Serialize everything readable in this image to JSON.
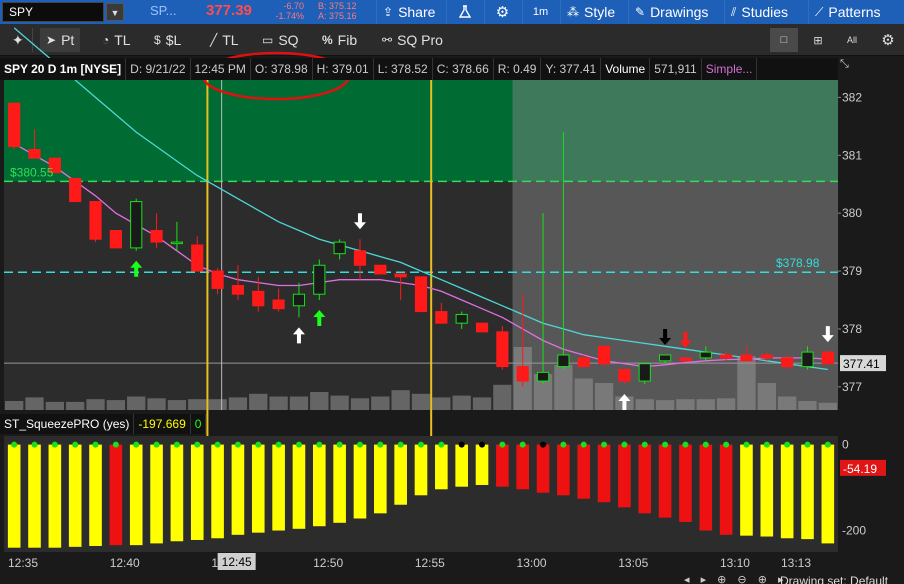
{
  "topbar": {
    "symbol": "SPY",
    "dropdown_glyph": "▼",
    "desc": "SP...",
    "last": "377.39",
    "net_change": "-6.70",
    "pct_change": "-1.74%",
    "bid": "B: 375.12",
    "ask": "A: 375.16",
    "share": "Share",
    "lab_icon": "flask-icon",
    "settings_icon": "gear-icon",
    "timeframe": "1m",
    "style": "Style",
    "drawings": "Drawings",
    "studies": "Studies",
    "patterns": "Patterns"
  },
  "toolbar": {
    "pin_glyph": "✦",
    "pointer": "Pt",
    "timeline": "TL",
    "price_level": "$L",
    "trendline": "TL",
    "sq": "SQ",
    "fib": "Fib",
    "sqpro": "SQ Pro",
    "right": [
      {
        "name": "single-layout-icon",
        "glyph": "□"
      },
      {
        "name": "grid-layout-icon",
        "glyph": "⊞"
      },
      {
        "name": "all-icon",
        "glyph": "All"
      },
      {
        "name": "gear-icon",
        "glyph": "⚙"
      }
    ]
  },
  "header": {
    "title": "SPY 20 D 1m [NYSE]",
    "date": "D: 9/21/22",
    "time": "12:45 PM",
    "open": "O: 378.98",
    "high": "H: 379.01",
    "low": "L: 378.52",
    "close": "C: 378.66",
    "range": "R: 0.49",
    "y": "Y: 377.41",
    "volume_label": "Volume",
    "volume": "571,911",
    "study": "Simple...",
    "collapse_glyph": "⤡"
  },
  "chart_data": [
    {
      "type": "candlestick",
      "y_ticks": [
        "382",
        "381",
        "380",
        "379",
        "378",
        "377"
      ],
      "x_ticks": [
        "12:35",
        "12:40",
        "12:45",
        "12:50",
        "12:55",
        "13:00",
        "13:05",
        "13:10",
        "13:13"
      ],
      "ylim": [
        376.6,
        382.3
      ],
      "price_label_left": "$380.55",
      "price_label_right": "$378.98",
      "last_price_label": "377.41",
      "crosshair_time_label": "12:45",
      "levels": [
        380.55,
        378.98
      ],
      "last_price": 377.41,
      "candles": [
        {
          "o": 381.9,
          "h": 381.9,
          "l": 381.1,
          "c": 381.15
        },
        {
          "o": 381.1,
          "h": 381.45,
          "l": 381.0,
          "c": 380.95
        },
        {
          "o": 380.95,
          "h": 380.95,
          "l": 380.7,
          "c": 380.7
        },
        {
          "o": 380.6,
          "h": 380.6,
          "l": 380.2,
          "c": 380.2
        },
        {
          "o": 380.2,
          "h": 380.2,
          "l": 379.5,
          "c": 379.55
        },
        {
          "o": 379.7,
          "h": 379.7,
          "l": 379.4,
          "c": 379.4
        },
        {
          "o": 379.4,
          "h": 380.25,
          "l": 379.35,
          "c": 380.2
        },
        {
          "o": 379.7,
          "h": 380.0,
          "l": 379.4,
          "c": 379.5
        },
        {
          "o": 379.5,
          "h": 379.85,
          "l": 379.35,
          "c": 379.5
        },
        {
          "o": 379.45,
          "h": 379.6,
          "l": 379.0,
          "c": 379.0
        },
        {
          "o": 379.0,
          "h": 379.05,
          "l": 378.6,
          "c": 378.7
        },
        {
          "o": 378.75,
          "h": 379.1,
          "l": 378.5,
          "c": 378.6
        },
        {
          "o": 378.65,
          "h": 378.9,
          "l": 378.3,
          "c": 378.4
        },
        {
          "o": 378.5,
          "h": 378.7,
          "l": 378.3,
          "c": 378.35
        },
        {
          "o": 378.4,
          "h": 378.8,
          "l": 378.2,
          "c": 378.6
        },
        {
          "o": 378.6,
          "h": 379.2,
          "l": 378.5,
          "c": 379.1
        },
        {
          "o": 379.3,
          "h": 379.55,
          "l": 379.2,
          "c": 379.5
        },
        {
          "o": 379.35,
          "h": 379.55,
          "l": 378.85,
          "c": 379.1
        },
        {
          "o": 379.1,
          "h": 379.1,
          "l": 378.95,
          "c": 378.95
        },
        {
          "o": 378.95,
          "h": 378.95,
          "l": 378.5,
          "c": 378.9
        },
        {
          "o": 378.9,
          "h": 378.9,
          "l": 378.3,
          "c": 378.3
        },
        {
          "o": 378.3,
          "h": 378.45,
          "l": 378.1,
          "c": 378.1
        },
        {
          "o": 378.1,
          "h": 378.3,
          "l": 378.0,
          "c": 378.25
        },
        {
          "o": 378.1,
          "h": 378.1,
          "l": 377.95,
          "c": 377.95
        },
        {
          "o": 377.95,
          "h": 378.05,
          "l": 377.3,
          "c": 377.35
        },
        {
          "o": 377.35,
          "h": 378.6,
          "l": 377.0,
          "c": 377.1
        },
        {
          "o": 377.1,
          "h": 380.0,
          "l": 377.05,
          "c": 377.25
        },
        {
          "o": 377.35,
          "h": 381.4,
          "l": 377.3,
          "c": 377.55
        },
        {
          "o": 377.5,
          "h": 377.55,
          "l": 377.35,
          "c": 377.35
        },
        {
          "o": 377.7,
          "h": 377.7,
          "l": 377.35,
          "c": 377.4
        },
        {
          "o": 377.3,
          "h": 377.3,
          "l": 377.05,
          "c": 377.1
        },
        {
          "o": 377.1,
          "h": 377.4,
          "l": 377.05,
          "c": 377.4
        },
        {
          "o": 377.45,
          "h": 377.55,
          "l": 377.4,
          "c": 377.55
        },
        {
          "o": 377.5,
          "h": 377.5,
          "l": 377.45,
          "c": 377.45
        },
        {
          "o": 377.5,
          "h": 377.7,
          "l": 377.45,
          "c": 377.6
        },
        {
          "o": 377.55,
          "h": 377.6,
          "l": 377.45,
          "c": 377.5
        },
        {
          "o": 377.55,
          "h": 377.7,
          "l": 377.45,
          "c": 377.45
        },
        {
          "o": 377.55,
          "h": 377.6,
          "l": 377.45,
          "c": 377.5
        },
        {
          "o": 377.5,
          "h": 377.55,
          "l": 377.3,
          "c": 377.35
        },
        {
          "o": 377.35,
          "h": 377.7,
          "l": 377.3,
          "c": 377.6
        },
        {
          "o": 377.6,
          "h": 377.6,
          "l": 377.4,
          "c": 377.4
        }
      ],
      "volume": [
        10,
        14,
        9,
        9,
        12,
        11,
        15,
        13,
        11,
        12,
        12,
        14,
        18,
        15,
        15,
        20,
        16,
        13,
        15,
        22,
        18,
        14,
        16,
        14,
        28,
        70,
        40,
        50,
        35,
        30,
        15,
        12,
        11,
        12,
        12,
        13,
        60,
        30,
        15,
        10,
        8
      ],
      "sma_slow": [
        383.2,
        382.9,
        382.6,
        382.3,
        382.0,
        381.7,
        381.4,
        381.15,
        380.9,
        380.65,
        380.45,
        380.25,
        380.05,
        379.85,
        379.7,
        379.55,
        379.45,
        379.35,
        379.25,
        379.15,
        379.0,
        378.85,
        378.7,
        378.55,
        378.4,
        378.25,
        378.1,
        378.0,
        377.9,
        377.85,
        377.8,
        377.75,
        377.7,
        377.65,
        377.6,
        377.55,
        377.5,
        377.45,
        377.4,
        377.35,
        377.3
      ],
      "sma_fast": [
        381.2,
        381.0,
        380.8,
        380.55,
        380.3,
        380.0,
        379.8,
        379.6,
        379.35,
        379.1,
        378.95,
        378.85,
        378.8,
        378.75,
        378.75,
        378.8,
        378.85,
        378.85,
        378.85,
        378.8,
        378.75,
        378.65,
        378.5,
        378.35,
        378.2,
        378.0,
        377.8,
        377.65,
        377.55,
        377.45,
        377.4,
        377.35,
        377.38,
        377.42,
        377.45,
        377.47,
        377.48,
        377.5,
        377.5,
        377.5,
        377.48
      ],
      "arrows": [
        {
          "i": 6,
          "dir": "up",
          "color": "#19ff19"
        },
        {
          "i": 14,
          "dir": "up",
          "color": "#ffffff"
        },
        {
          "i": 15,
          "dir": "up",
          "color": "#19ff19"
        },
        {
          "i": 17,
          "dir": "down",
          "color": "#ffffff"
        },
        {
          "i": 30,
          "dir": "up",
          "color": "#ffffff"
        },
        {
          "i": 32,
          "dir": "down",
          "color": "#000000"
        },
        {
          "i": 33,
          "dir": "down",
          "color": "#ff1a1a"
        },
        {
          "i": 40,
          "dir": "down",
          "color": "#ffffff"
        }
      ]
    },
    {
      "type": "bar",
      "name": "ST_SqueezePRO (yes)",
      "value_label": "-197.669",
      "zero_label": "0",
      "y_ticks": [
        "0",
        "-200"
      ],
      "ylim": [
        -250,
        20
      ],
      "last_label": "-54.19",
      "values": [
        -240,
        -240,
        -240,
        -238,
        -236,
        -234,
        -234,
        -230,
        -225,
        -222,
        -218,
        -210,
        -205,
        -200,
        -196,
        -190,
        -182,
        -172,
        -160,
        -140,
        -118,
        -104,
        -98,
        -94,
        -98,
        -104,
        -112,
        -118,
        -126,
        -134,
        -146,
        -160,
        -170,
        -180,
        -200,
        -210,
        -212,
        -214,
        -218,
        -220,
        -230
      ],
      "colors": [
        "yellow",
        "yellow",
        "yellow",
        "yellow",
        "yellow",
        "red",
        "yellow",
        "yellow",
        "yellow",
        "yellow",
        "yellow",
        "yellow",
        "yellow",
        "yellow",
        "yellow",
        "yellow",
        "yellow",
        "yellow",
        "yellow",
        "yellow",
        "yellow",
        "yellow",
        "yellow",
        "yellow",
        "red",
        "red",
        "red",
        "red",
        "red",
        "red",
        "red",
        "red",
        "red",
        "red",
        "red",
        "red",
        "yellow",
        "yellow",
        "yellow",
        "yellow",
        "yellow"
      ],
      "dots": [
        "g",
        "g",
        "g",
        "g",
        "g",
        "g",
        "g",
        "g",
        "g",
        "g",
        "g",
        "g",
        "g",
        "g",
        "g",
        "g",
        "g",
        "g",
        "g",
        "g",
        "g",
        "g",
        "b",
        "b",
        "g",
        "g",
        "b",
        "g",
        "g",
        "g",
        "g",
        "g",
        "g",
        "g",
        "g",
        "g",
        "g",
        "g",
        "g",
        "g",
        "g"
      ]
    }
  ],
  "bottom": {
    "drawing_set": "Drawing set: Default",
    "nav_icons": "◂ ▸ ⊕ ⊖ ⊕ ▸"
  }
}
